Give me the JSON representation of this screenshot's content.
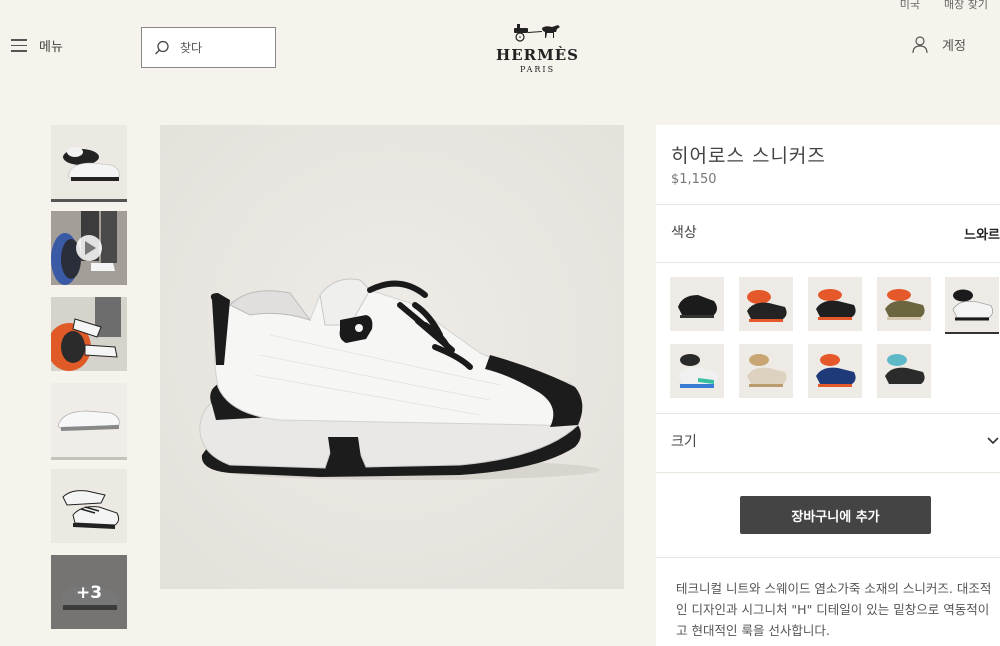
{
  "header": {
    "util_links": [
      "미국",
      "매장 찾기"
    ],
    "menu_label": "메뉴",
    "search_placeholder": "찾다",
    "logo_text": "HERMÈS",
    "logo_sub": "PARIS",
    "account_label": "계정"
  },
  "gallery": {
    "more_count_label": "+3"
  },
  "product": {
    "title": "히어로스 스니커즈",
    "price": "$1,150",
    "color_label": "색상",
    "color_value": "느와르",
    "size_label": "크기",
    "add_to_cart_label": "장바구니에 추가",
    "description": "테크니컬 니트와 스웨이드 염소가죽 소재의 스니커즈. 대조적인 디자인과 시그니처 \"H\" 디테일이 있는 밑창으로 역동적이고 현대적인 룩을 선사합니다."
  },
  "colors": {
    "accent_button": "#444444",
    "background": "#f6f2ec"
  }
}
